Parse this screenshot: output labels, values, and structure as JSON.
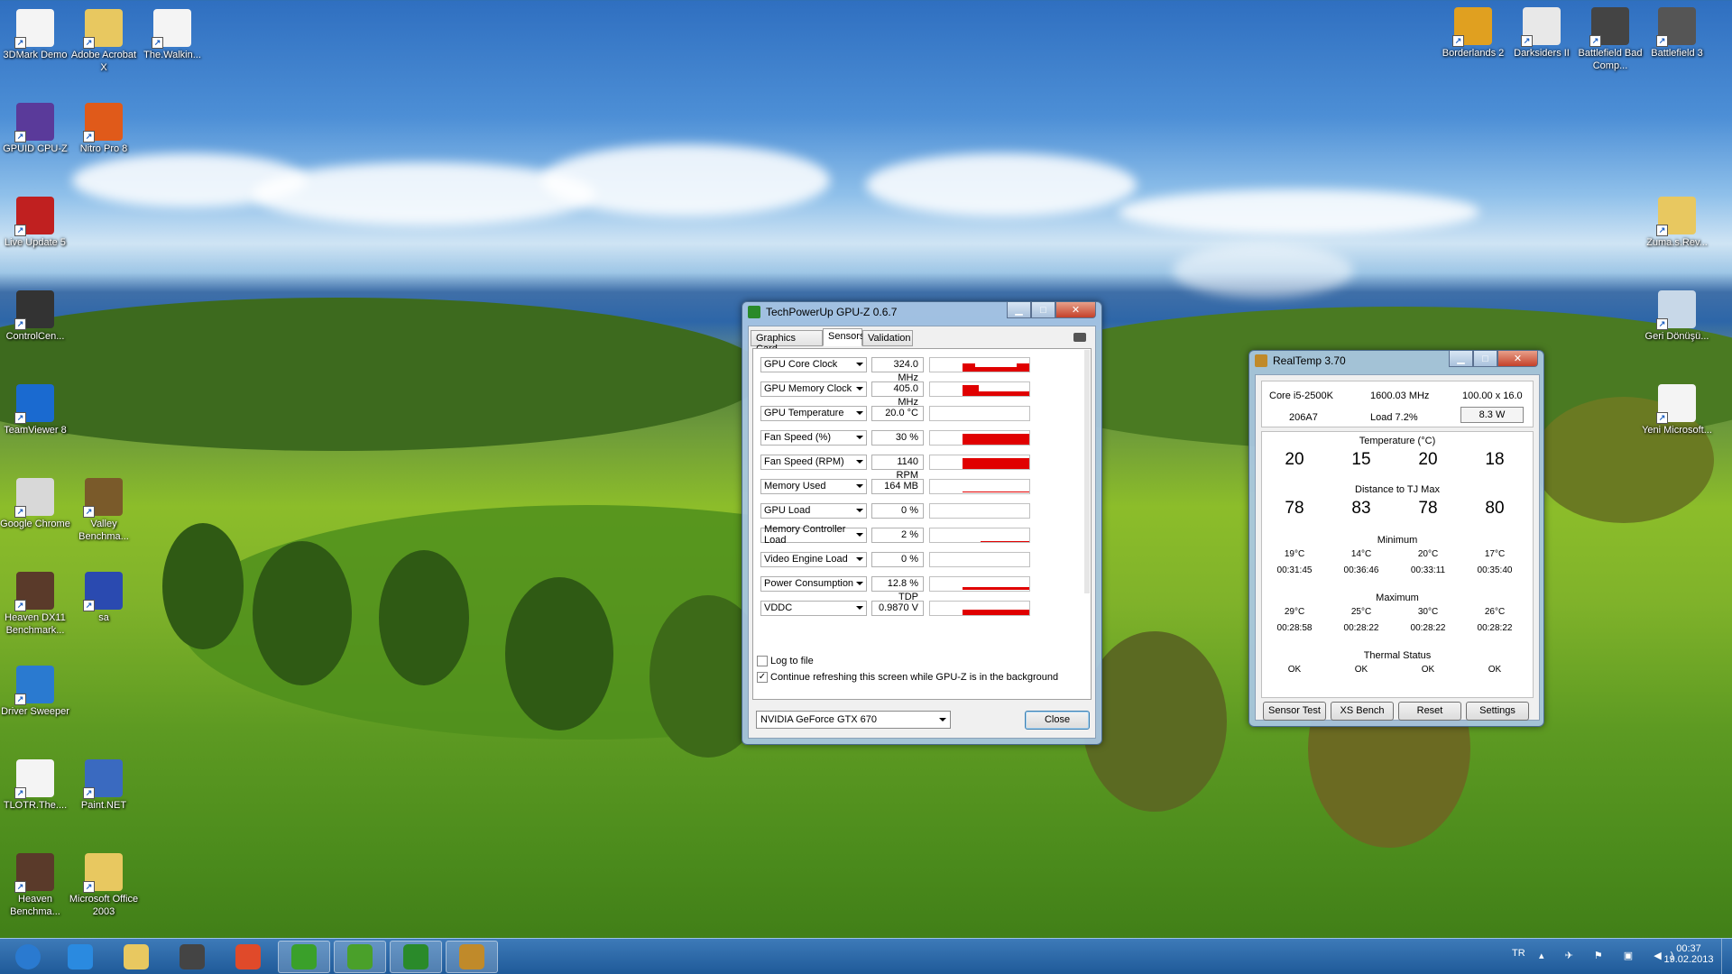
{
  "desktop": {
    "icons_left": [
      {
        "label": "3DMark Demo",
        "icon": "document-icon"
      },
      {
        "label": "Adobe Acrobat X",
        "icon": "folder-icon"
      },
      {
        "label": "The.Walkin...",
        "icon": "document-icon"
      },
      {
        "label": "GPUID CPU-Z",
        "icon": "cpuz-icon"
      },
      {
        "label": "Nitro Pro 8",
        "icon": "nitro-icon"
      },
      {
        "label": "Live Update 5",
        "icon": "live-update-icon"
      },
      {
        "label": "ControlCen...",
        "icon": "msi-icon"
      },
      {
        "label": "TeamViewer 8",
        "icon": "teamviewer-icon"
      },
      {
        "label": "Google Chrome",
        "icon": "chrome-icon"
      },
      {
        "label": "Valley Benchma...",
        "icon": "valley-icon"
      },
      {
        "label": "Heaven DX11 Benchmark...",
        "icon": "heaven-icon"
      },
      {
        "label": "sa",
        "icon": "image-icon"
      },
      {
        "label": "Driver Sweeper",
        "icon": "driver-sweeper-icon"
      },
      {
        "label": "TLOTR.The....",
        "icon": "document-icon"
      },
      {
        "label": "Paint.NET",
        "icon": "paintnet-icon"
      },
      {
        "label": "Heaven Benchma...",
        "icon": "heaven-icon"
      },
      {
        "label": "Microsoft Office 2003",
        "icon": "folder-icon"
      }
    ],
    "icons_right": [
      {
        "label": "Borderlands 2",
        "icon": "borderlands-icon"
      },
      {
        "label": "Darksiders II",
        "icon": "darksiders-icon"
      },
      {
        "label": "Battlefield Bad Comp...",
        "icon": "battlefield-icon"
      },
      {
        "label": "Battlefield 3",
        "icon": "battlefield3-icon"
      },
      {
        "label": "Zuma.s.Rev...",
        "icon": "folder-icon"
      },
      {
        "label": "Geri Dönüşü...",
        "icon": "recycle-bin-icon"
      },
      {
        "label": "Yeni Microsoft...",
        "icon": "document-icon"
      }
    ]
  },
  "gpuz": {
    "title": "TechPowerUp GPU-Z 0.6.7",
    "tabs": [
      "Graphics Card",
      "Sensors",
      "Validation"
    ],
    "active_tab": "Sensors",
    "sensors": [
      {
        "name": "GPU Core Clock",
        "value": "324.0 MHz"
      },
      {
        "name": "GPU Memory Clock",
        "value": "405.0 MHz"
      },
      {
        "name": "GPU Temperature",
        "value": "20.0 °C"
      },
      {
        "name": "Fan Speed (%)",
        "value": "30 %"
      },
      {
        "name": "Fan Speed (RPM)",
        "value": "1140 RPM"
      },
      {
        "name": "Memory Used",
        "value": "164 MB"
      },
      {
        "name": "GPU Load",
        "value": "0 %"
      },
      {
        "name": "Memory Controller Load",
        "value": "2 %"
      },
      {
        "name": "Video Engine Load",
        "value": "0 %"
      },
      {
        "name": "Power Consumption",
        "value": "12.8 % TDP"
      },
      {
        "name": "VDDC",
        "value": "0.9870 V"
      }
    ],
    "log_to_file": "Log to file",
    "continue_refresh": "Continue refreshing this screen while GPU-Z is in the background",
    "continue_refresh_checked": true,
    "gpu_select": "NVIDIA GeForce GTX 670",
    "close_label": "Close",
    "graph_color": "#e00000"
  },
  "realtemp": {
    "title": "RealTemp 3.70",
    "cpu": "Core i5-2500K",
    "cpu_id": "206A7",
    "freq": "1600.03 MHz",
    "multiplier": "100.00 x 16.0",
    "load": "Load  7.2%",
    "power": "8.3 W",
    "temp_title": "Temperature (°C)",
    "temps": [
      "20",
      "15",
      "20",
      "18"
    ],
    "dist_title": "Distance to TJ Max",
    "dist": [
      "78",
      "83",
      "78",
      "80"
    ],
    "min_title": "Minimum",
    "min_temps": [
      "19°C",
      "14°C",
      "20°C",
      "17°C"
    ],
    "min_times": [
      "00:31:45",
      "00:36:46",
      "00:33:11",
      "00:35:40"
    ],
    "max_title": "Maximum",
    "max_temps": [
      "29°C",
      "25°C",
      "30°C",
      "26°C"
    ],
    "max_times": [
      "00:28:58",
      "00:28:22",
      "00:28:22",
      "00:28:22"
    ],
    "thermal_title": "Thermal Status",
    "thermal": [
      "OK",
      "OK",
      "OK",
      "OK"
    ],
    "buttons": [
      "Sensor Test",
      "XS Bench",
      "Reset",
      "Settings"
    ]
  },
  "taskbar": {
    "apps": [
      "start-orb-icon",
      "internet-explorer-icon",
      "explorer-icon",
      "media-center-icon",
      "chrome-icon",
      "utorrent-icon",
      "messenger-icon",
      "gpuz-icon",
      "realtemp-icon"
    ],
    "language": "TR",
    "time": "00:37",
    "date": "19.02.2013"
  }
}
